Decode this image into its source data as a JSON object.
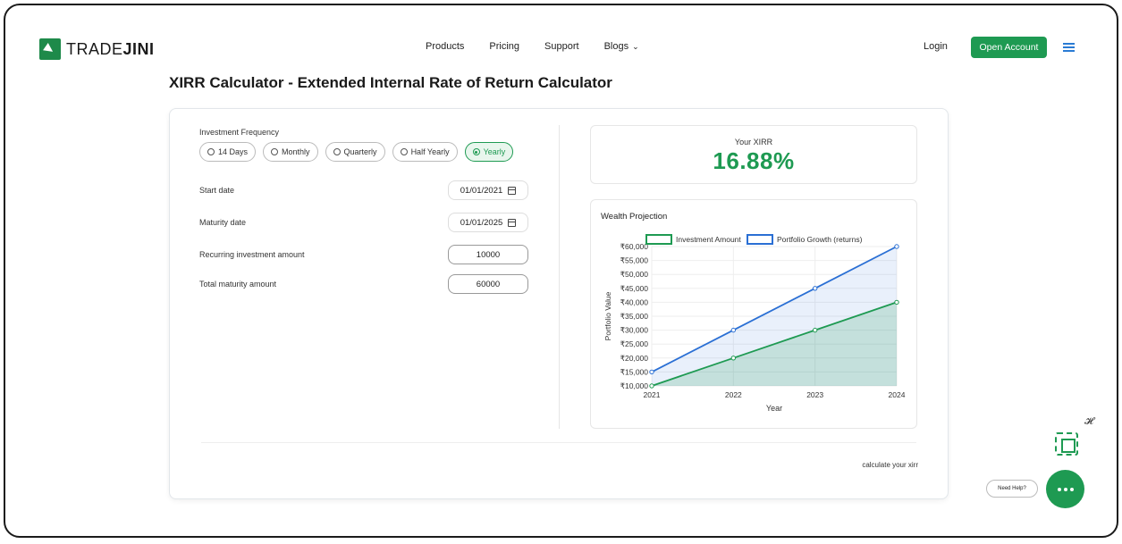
{
  "header": {
    "logo_light": "TRADE",
    "logo_bold": "JINI",
    "nav": [
      "Products",
      "Pricing",
      "Support",
      "Blogs"
    ],
    "login": "Login",
    "open_account": "Open Account"
  },
  "page_title": "XIRR Calculator - Extended Internal Rate of Return Calculator",
  "form": {
    "frequency_label": "Investment Frequency",
    "frequency_options": [
      "14 Days",
      "Monthly",
      "Quarterly",
      "Half Yearly",
      "Yearly"
    ],
    "selected_frequency": "Yearly",
    "start_date_label": "Start date",
    "start_date": "01/01/2021",
    "maturity_date_label": "Maturity date",
    "maturity_date": "01/01/2025",
    "recurring_label": "Recurring investment amount",
    "recurring_amount": "10000",
    "total_label": "Total maturity amount",
    "total_amount": "60000"
  },
  "result": {
    "label": "Your XIRR",
    "value": "16.88%"
  },
  "chart_title": "Wealth Projection",
  "footer_note": "calculate your xirr",
  "need_help": "Need Help?",
  "colors": {
    "accent": "#1e9a52",
    "series_blue": "#2a6fd4"
  },
  "chart_data": {
    "type": "area",
    "title": "Wealth Projection",
    "xlabel": "Year",
    "ylabel": "Portfolio Value",
    "categories": [
      "2021",
      "2022",
      "2023",
      "2024"
    ],
    "series": [
      {
        "name": "Investment Amount",
        "values": [
          10000,
          20000,
          30000,
          40000
        ]
      },
      {
        "name": "Portfolio Growth (returns)",
        "values": [
          15000,
          30000,
          45000,
          60000
        ]
      }
    ],
    "ylim": [
      10000,
      60000
    ],
    "yticks": [
      "₹10,000",
      "₹15,000",
      "₹20,000",
      "₹25,000",
      "₹30,000",
      "₹35,000",
      "₹40,000",
      "₹45,000",
      "₹50,000",
      "₹55,000",
      "₹60,000"
    ],
    "legend": "top",
    "grid": true
  }
}
